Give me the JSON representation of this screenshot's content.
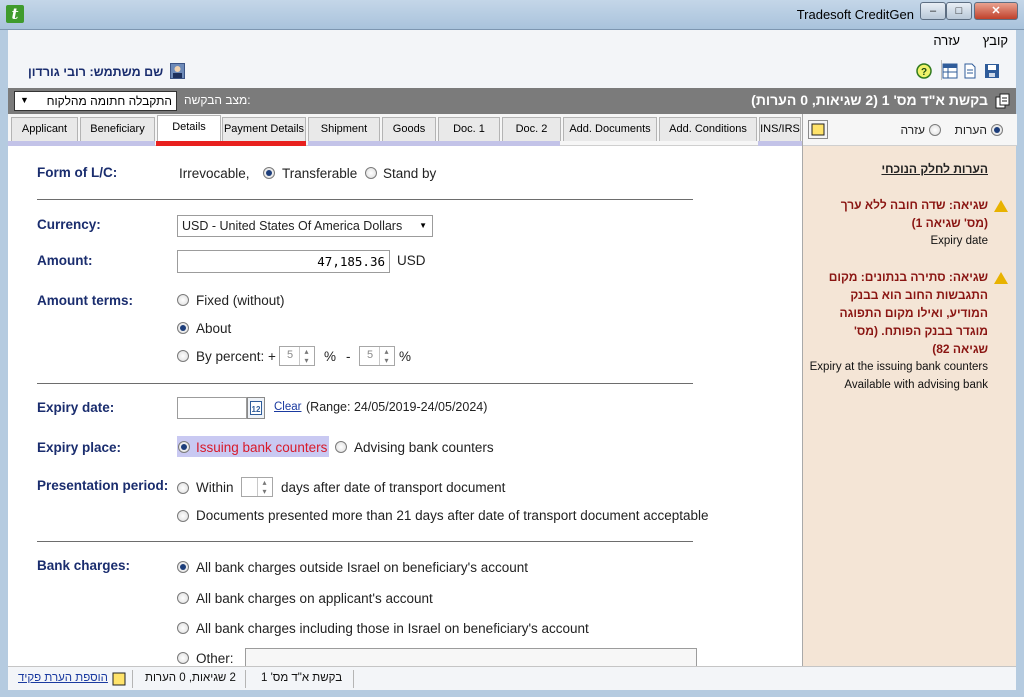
{
  "window": {
    "title": "Tradesoft CreditGen",
    "min": "–",
    "max": "□",
    "close": "✕"
  },
  "menu": {
    "file": "קובץ",
    "help": "עזרה"
  },
  "user": {
    "label": "שם משתמש: רובי גורדון"
  },
  "request": {
    "status_label": "מצב הבקשה:",
    "status_value": "התקבלה חתומה מהלקוח",
    "title": "בקשת א\"ד מס' 1 (2 שגיאות, 0 הערות)"
  },
  "tabs": [
    "Applicant",
    "Beneficiary",
    "Details",
    "Payment Details",
    "Shipment",
    "Goods",
    "Doc. 1",
    "Doc. 2",
    "Add. Documents",
    "Add. Conditions",
    "INS/IRS"
  ],
  "form": {
    "lc_form": {
      "label": "Form of L/C:",
      "irrevocable": "Irrevocable,",
      "transferable": "Transferable",
      "standby": "Stand by"
    },
    "currency": {
      "label": "Currency:",
      "value": "USD - United States Of America Dollars"
    },
    "amount": {
      "label": "Amount:",
      "value": "47,185.36",
      "unit": "USD"
    },
    "amount_terms": {
      "label": "Amount terms:",
      "fixed": "Fixed (without)",
      "about": "About",
      "by_percent": "By percent: +",
      "plus_value": "5",
      "percent": "%",
      "minus": "-",
      "minus_value": "5"
    },
    "expiry_date": {
      "label": "Expiry date:",
      "calendar_day": "12",
      "clear": "Clear",
      "range": "(Range: 24/05/2019-24/05/2024)"
    },
    "expiry_place": {
      "label": "Expiry place:",
      "issuing": "Issuing bank counters",
      "advising": "Advising bank counters"
    },
    "presentation": {
      "label": "Presentation period:",
      "within": "Within",
      "days_after": "days after date of transport document",
      "more_than_21": "Documents presented more than 21 days after date of transport document acceptable"
    },
    "bank_charges": {
      "label": "Bank charges:",
      "opt1": "All bank charges outside Israel on beneficiary's account",
      "opt2": "All bank charges on applicant's account",
      "opt3": "All bank charges including those in Israel on beneficiary's account",
      "other": "Other:"
    }
  },
  "notes": {
    "radio_notes": "הערות",
    "radio_help": "עזרה",
    "heading": "הערות לחלק הנוכחי",
    "err1_title": "שגיאה: שדה חובה ללא ערך (מס' שגיאה 1)",
    "err1_field": "Expiry date",
    "err2_title": "שגיאה: סתירה בנתונים: מקום התגבשות החוב הוא בבנק המודיע, ואילו מקום התפוגה מוגדר בבנק הפותח. (מס' שגיאה 82)",
    "err2_line1": "Expiry at the issuing bank counters",
    "err2_line2": "Available with advising bank"
  },
  "statusbar": {
    "request": "בקשת א\"ד מס' 1",
    "counts": "2 שגיאות, 0 הערות",
    "add_note": "הוספת הערת פקיד"
  },
  "colors": {
    "error_text": "#8a1512",
    "label_blue": "#1a2d6e",
    "active_tab_line": "#e8201e",
    "highlight": "#c9c9f2"
  }
}
